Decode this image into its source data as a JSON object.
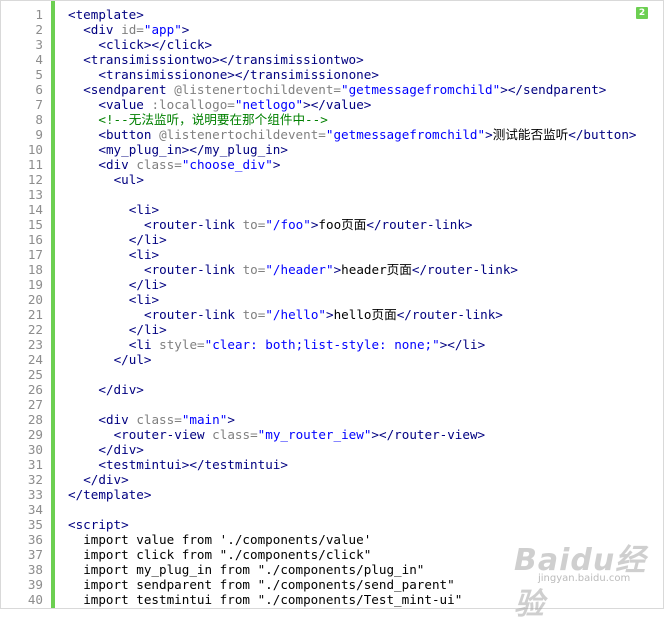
{
  "editor": {
    "change_badge": "2",
    "lines": [
      {
        "n": "1",
        "indent": 0,
        "tokens": [
          [
            "tag",
            "<template>"
          ]
        ]
      },
      {
        "n": "2",
        "indent": 1,
        "tokens": [
          [
            "tag",
            "<div "
          ],
          [
            "attr",
            "id="
          ],
          [
            "str",
            "\"app\""
          ],
          [
            "tag",
            ">"
          ]
        ]
      },
      {
        "n": "3",
        "indent": 2,
        "tokens": [
          [
            "tag",
            "<click></click>"
          ]
        ]
      },
      {
        "n": "4",
        "indent": 1,
        "tokens": [
          [
            "tag",
            "<transimissiontwo></transimissiontwo>"
          ]
        ]
      },
      {
        "n": "5",
        "indent": 2,
        "tokens": [
          [
            "tag",
            "<transimissionone></transimissionone>"
          ]
        ]
      },
      {
        "n": "6",
        "indent": 1,
        "tokens": [
          [
            "tag",
            "<sendparent "
          ],
          [
            "attr",
            "@listenertochildevent="
          ],
          [
            "str",
            "\"getmessagefromchild\""
          ],
          [
            "tag",
            "></sendparent>"
          ]
        ]
      },
      {
        "n": "7",
        "indent": 2,
        "tokens": [
          [
            "tag",
            "<value "
          ],
          [
            "attr",
            ":locallogo="
          ],
          [
            "str",
            "\"netlogo\""
          ],
          [
            "tag",
            "></value>"
          ]
        ]
      },
      {
        "n": "8",
        "indent": 2,
        "tokens": [
          [
            "cm",
            "<!--无法监听，说明要在那个组件中-->"
          ]
        ]
      },
      {
        "n": "9",
        "indent": 2,
        "tokens": [
          [
            "tag",
            "<button "
          ],
          [
            "attr",
            "@listenertochildevent="
          ],
          [
            "str",
            "\"getmessagefromchild\""
          ],
          [
            "tag",
            ">"
          ],
          [
            "tx",
            "测试能否监听"
          ],
          [
            "tag",
            "</button>"
          ]
        ]
      },
      {
        "n": "10",
        "indent": 2,
        "tokens": [
          [
            "tag",
            "<my_plug_in></my_plug_in>"
          ]
        ]
      },
      {
        "n": "11",
        "indent": 2,
        "tokens": [
          [
            "tag",
            "<div "
          ],
          [
            "attr",
            "class="
          ],
          [
            "str",
            "\"choose_div\""
          ],
          [
            "tag",
            ">"
          ]
        ]
      },
      {
        "n": "12",
        "indent": 3,
        "tokens": [
          [
            "tag",
            "<ul>"
          ]
        ]
      },
      {
        "n": "13",
        "indent": 0,
        "tokens": []
      },
      {
        "n": "14",
        "indent": 4,
        "tokens": [
          [
            "tag",
            "<li>"
          ]
        ]
      },
      {
        "n": "15",
        "indent": 5,
        "tokens": [
          [
            "tag",
            "<router-link "
          ],
          [
            "attr",
            "to="
          ],
          [
            "str",
            "\"/foo\""
          ],
          [
            "tag",
            ">"
          ],
          [
            "tx",
            "foo页面"
          ],
          [
            "tag",
            "</router-link>"
          ]
        ]
      },
      {
        "n": "16",
        "indent": 4,
        "tokens": [
          [
            "tag",
            "</li>"
          ]
        ]
      },
      {
        "n": "17",
        "indent": 4,
        "tokens": [
          [
            "tag",
            "<li>"
          ]
        ]
      },
      {
        "n": "18",
        "indent": 5,
        "tokens": [
          [
            "tag",
            "<router-link "
          ],
          [
            "attr",
            "to="
          ],
          [
            "str",
            "\"/header\""
          ],
          [
            "tag",
            ">"
          ],
          [
            "tx",
            "header页面"
          ],
          [
            "tag",
            "</router-link>"
          ]
        ]
      },
      {
        "n": "19",
        "indent": 4,
        "tokens": [
          [
            "tag",
            "</li>"
          ]
        ]
      },
      {
        "n": "20",
        "indent": 4,
        "tokens": [
          [
            "tag",
            "<li>"
          ]
        ]
      },
      {
        "n": "21",
        "indent": 5,
        "tokens": [
          [
            "tag",
            "<router-link "
          ],
          [
            "attr",
            "to="
          ],
          [
            "str",
            "\"/hello\""
          ],
          [
            "tag",
            ">"
          ],
          [
            "tx",
            "hello页面"
          ],
          [
            "tag",
            "</router-link>"
          ]
        ]
      },
      {
        "n": "22",
        "indent": 4,
        "tokens": [
          [
            "tag",
            "</li>"
          ]
        ]
      },
      {
        "n": "23",
        "indent": 4,
        "tokens": [
          [
            "tag",
            "<li "
          ],
          [
            "attr",
            "style="
          ],
          [
            "str",
            "\"clear: both;list-style: none;\""
          ],
          [
            "tag",
            "></li>"
          ]
        ]
      },
      {
        "n": "24",
        "indent": 3,
        "tokens": [
          [
            "tag",
            "</ul>"
          ]
        ]
      },
      {
        "n": "25",
        "indent": 0,
        "tokens": []
      },
      {
        "n": "26",
        "indent": 2,
        "tokens": [
          [
            "tag",
            "</div>"
          ]
        ]
      },
      {
        "n": "27",
        "indent": 0,
        "tokens": []
      },
      {
        "n": "28",
        "indent": 2,
        "tokens": [
          [
            "tag",
            "<div "
          ],
          [
            "attr",
            "class="
          ],
          [
            "str",
            "\"main\""
          ],
          [
            "tag",
            ">"
          ]
        ]
      },
      {
        "n": "29",
        "indent": 3,
        "tokens": [
          [
            "tag",
            "<router-view "
          ],
          [
            "attr",
            "class="
          ],
          [
            "str",
            "\"my_router_iew\""
          ],
          [
            "tag",
            "></router-view>"
          ]
        ]
      },
      {
        "n": "30",
        "indent": 2,
        "tokens": [
          [
            "tag",
            "</div>"
          ]
        ]
      },
      {
        "n": "31",
        "indent": 2,
        "tokens": [
          [
            "tag",
            "<testmintui></testmintui>"
          ]
        ]
      },
      {
        "n": "32",
        "indent": 1,
        "tokens": [
          [
            "tag",
            "</div>"
          ]
        ]
      },
      {
        "n": "33",
        "indent": 0,
        "tokens": [
          [
            "tag",
            "</template>"
          ]
        ]
      },
      {
        "n": "34",
        "indent": 0,
        "tokens": []
      },
      {
        "n": "35",
        "indent": 0,
        "tokens": [
          [
            "tag",
            "<script>"
          ]
        ]
      },
      {
        "n": "36",
        "indent": 1,
        "tokens": [
          [
            "kw",
            "import value from './components/value'"
          ]
        ]
      },
      {
        "n": "37",
        "indent": 1,
        "tokens": [
          [
            "kw",
            "import click from \"./components/click\""
          ]
        ]
      },
      {
        "n": "38",
        "indent": 1,
        "tokens": [
          [
            "kw",
            "import my_plug_in from \"./components/plug_in\""
          ]
        ]
      },
      {
        "n": "39",
        "indent": 1,
        "tokens": [
          [
            "kw",
            "import sendparent from \"./components/send_parent\""
          ]
        ]
      },
      {
        "n": "40",
        "indent": 1,
        "tokens": [
          [
            "kw",
            "import testmintui from \"./components/Test_mint-ui\""
          ]
        ]
      }
    ]
  },
  "watermark": {
    "brand": "Baidu经验",
    "url": "jingyan.baidu.com"
  },
  "colors": {
    "gutter_bar": "#6ccf51",
    "tag": "#000080",
    "attribute": "#808080",
    "string": "#0000ff",
    "comment": "#008000"
  }
}
